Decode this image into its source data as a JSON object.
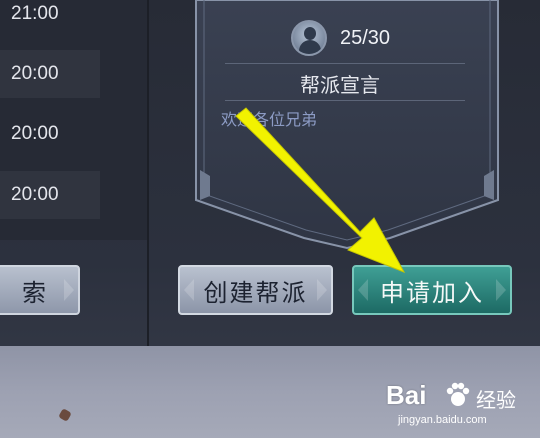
{
  "time_list": [
    "21:00",
    "20:00",
    "20:00",
    "20:00"
  ],
  "guild_card": {
    "top_title": "",
    "member_count": "25/30",
    "section_title": "帮派宣言",
    "declaration": "欢迎各位兄弟"
  },
  "buttons": {
    "search_label": "索",
    "create_label": "创建帮派",
    "apply_label": "申请加入"
  },
  "icons": {
    "avatar": "member-avatar-icon",
    "arrow": "pointer-arrow"
  },
  "watermark": {
    "brand": "Bai",
    "cn": "经验",
    "url": "jingyan.baidu.com"
  },
  "colors": {
    "apply_button": "#2a8078",
    "create_button": "#a3abbb",
    "arrow": "#f2f200"
  }
}
